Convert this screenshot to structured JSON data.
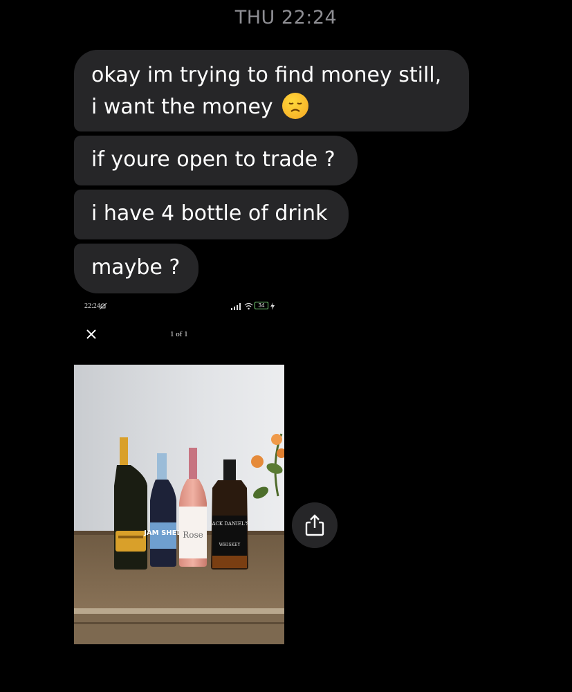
{
  "header": {
    "timestamp": "THU 22:24"
  },
  "messages": [
    {
      "line1": "okay im trying to find money still,",
      "line2": "i want the money",
      "emoji": "disappointed-face"
    },
    {
      "text": "if youre open to trade ?"
    },
    {
      "text": "i have 4 bottle of drink"
    },
    {
      "text": "maybe ?"
    }
  ],
  "attachment": {
    "status_time": "22:24",
    "battery": "34",
    "counter": "1 of 1",
    "bottle_labels": [
      "JAM SHED",
      "Rose",
      "JACK DANIEL'S",
      "WHISKEY"
    ],
    "share_icon": "share-icon"
  },
  "colors": {
    "bubble": "#262628",
    "background": "#000000",
    "timestamp": "#8e8e93"
  }
}
